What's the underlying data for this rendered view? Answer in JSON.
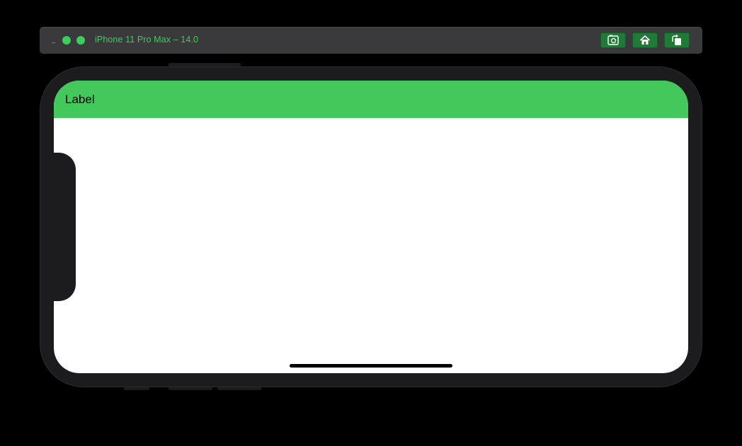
{
  "window": {
    "title": "iPhone 11 Pro Max – 14.0",
    "buttons": [
      {
        "name": "screenshot",
        "icon": "camera-icon"
      },
      {
        "name": "home",
        "icon": "home-icon"
      },
      {
        "name": "rotate",
        "icon": "rotate-icon"
      }
    ]
  },
  "app": {
    "nav_label": "Label",
    "colors": {
      "nav_background": "#43c85c",
      "accent": "#3ccd5c",
      "device_body": "#1c1c1e",
      "screen_background": "#ffffff"
    }
  }
}
